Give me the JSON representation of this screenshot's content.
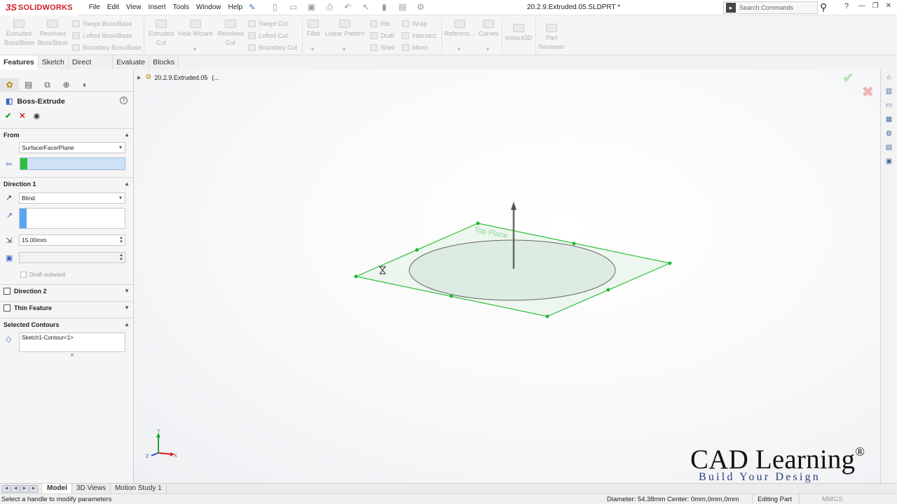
{
  "app": {
    "logo_ds": "3S",
    "logo_name": "SOLIDWORKS",
    "doc_title": "20.2.9.Extruded.05.SLDPRT *",
    "menu": [
      "File",
      "Edit",
      "View",
      "Insert",
      "Tools",
      "Window",
      "Help"
    ],
    "search_placeholder": "Search Commands",
    "help": "?"
  },
  "ribbon": {
    "extruded_boss": [
      "Extruded",
      "Boss/Base"
    ],
    "revolved_boss": [
      "Revolved",
      "Boss/Base"
    ],
    "swept_boss": "Swept Boss/Base",
    "lofted_boss": "Lofted Boss/Base",
    "boundary_boss": "Boundary Boss/Base",
    "extruded_cut": [
      "Extruded",
      "Cut"
    ],
    "hole_wizard": "Hole Wizard",
    "revolved_cut": [
      "Revolved",
      "Cut"
    ],
    "swept_cut": "Swept Cut",
    "lofted_cut": "Lofted Cut",
    "boundary_cut": "Boundary Cut",
    "fillet": "Fillet",
    "linear_pattern": "Linear Pattern",
    "rib": "Rib",
    "draft": "Draft",
    "shell": "Shell",
    "wrap": "Wrap",
    "intersect": "Intersect",
    "mirror": "Mirror",
    "reference": "Referenc...",
    "curves": "Curves",
    "instant3d": "Instant3D",
    "part_reviewer": [
      "Part",
      "Reviewer"
    ]
  },
  "tabs": [
    "Features",
    "Sketch",
    "Direct Editing",
    "Evaluate",
    "Blocks"
  ],
  "property_manager": {
    "title": "Boss-Extrude",
    "from": {
      "label": "From",
      "start_condition": "Surface/Face/Plane"
    },
    "direction1": {
      "label": "Direction 1",
      "end_condition": "Blind",
      "depth": "15.00mm",
      "draft_outward": "Draft outward"
    },
    "direction2": {
      "label": "Direction 2"
    },
    "thin_feature": {
      "label": "Thin Feature"
    },
    "selected_contours": {
      "label": "Selected Contours",
      "items": [
        "Sketch1-Contour<1>"
      ]
    }
  },
  "viewport": {
    "tree_item": "20.2.9.Extruded.05",
    "tree_suffix": "(...",
    "plane_label": "Top Plane",
    "brand_main": "CAD Learning",
    "brand_reg": "®",
    "brand_sub": "Build Your Design",
    "triad": {
      "y": "Y",
      "z": "Z",
      "x": "X"
    }
  },
  "bottom_tabs": [
    "Model",
    "3D Views",
    "Motion Study 1"
  ],
  "status": {
    "message": "Select a handle to modify parameters",
    "diameter": "Diameter: 54.38mm  Center: 0mm,0mm,0mm",
    "mode": "Editing Part",
    "units": "MMGS"
  },
  "colors": {
    "brand_red": "#d0202a",
    "plane_green": "#2fbf3a",
    "ok_green": "#1e9e2c",
    "cancel_red": "#d02020",
    "selection_blue": "#cfe2f5",
    "accent_blue": "#3a68c4"
  }
}
